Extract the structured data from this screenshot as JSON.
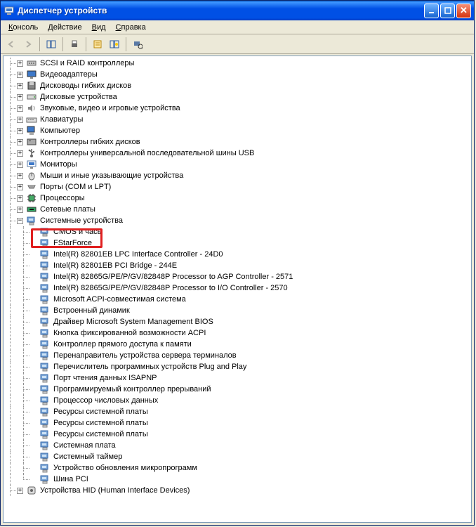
{
  "window": {
    "title": "Диспетчер устройств"
  },
  "menu": {
    "console": "Консоль",
    "action": "Действие",
    "view": "Вид",
    "help": "Справка"
  },
  "tree": [
    {
      "label": "SCSI и RAID контроллеры",
      "expand": "+",
      "icon": "scsi",
      "depth": 1
    },
    {
      "label": "Видеоадаптеры",
      "expand": "+",
      "icon": "display",
      "depth": 1
    },
    {
      "label": "Дисководы гибких дисков",
      "expand": "+",
      "icon": "floppy",
      "depth": 1
    },
    {
      "label": "Дисковые устройства",
      "expand": "+",
      "icon": "disk",
      "depth": 1
    },
    {
      "label": "Звуковые, видео и игровые устройства",
      "expand": "+",
      "icon": "sound",
      "depth": 1
    },
    {
      "label": "Клавиатуры",
      "expand": "+",
      "icon": "keyboard",
      "depth": 1
    },
    {
      "label": "Компьютер",
      "expand": "+",
      "icon": "computer",
      "depth": 1
    },
    {
      "label": "Контроллеры гибких дисков",
      "expand": "+",
      "icon": "fdc",
      "depth": 1
    },
    {
      "label": "Контроллеры универсальной последовательной шины USB",
      "expand": "+",
      "icon": "usb",
      "depth": 1
    },
    {
      "label": "Мониторы",
      "expand": "+",
      "icon": "monitor",
      "depth": 1
    },
    {
      "label": "Мыши и иные указывающие устройства",
      "expand": "+",
      "icon": "mouse",
      "depth": 1
    },
    {
      "label": "Порты (COM и LPT)",
      "expand": "+",
      "icon": "port",
      "depth": 1
    },
    {
      "label": "Процессоры",
      "expand": "+",
      "icon": "cpu",
      "depth": 1
    },
    {
      "label": "Сетевые платы",
      "expand": "+",
      "icon": "net",
      "depth": 1
    },
    {
      "label": "Системные устройства",
      "expand": "-",
      "icon": "system",
      "depth": 1
    },
    {
      "label": "CMOS и часы",
      "expand": "",
      "icon": "system",
      "depth": 2,
      "obscured": true
    },
    {
      "label": "FStarForce",
      "expand": "",
      "icon": "system",
      "depth": 2,
      "highlighted": true
    },
    {
      "label": "Intel(R) 82801EB LPC Interface Controller - 24D0",
      "expand": "",
      "icon": "system",
      "depth": 2
    },
    {
      "label": "Intel(R) 82801EB PCI Bridge - 244E",
      "expand": "",
      "icon": "system",
      "depth": 2
    },
    {
      "label": "Intel(R) 82865G/PE/P/GV/82848P Processor to AGP Controller - 2571",
      "expand": "",
      "icon": "system",
      "depth": 2
    },
    {
      "label": "Intel(R) 82865G/PE/P/GV/82848P Processor to I/O Controller - 2570",
      "expand": "",
      "icon": "system",
      "depth": 2
    },
    {
      "label": "Microsoft ACPI-совместимая система",
      "expand": "",
      "icon": "system",
      "depth": 2
    },
    {
      "label": "Встроенный динамик",
      "expand": "",
      "icon": "system",
      "depth": 2
    },
    {
      "label": "Драйвер Microsoft System Management BIOS",
      "expand": "",
      "icon": "system",
      "depth": 2
    },
    {
      "label": "Кнопка фиксированной возможности ACPI",
      "expand": "",
      "icon": "system",
      "depth": 2
    },
    {
      "label": "Контроллер прямого доступа к памяти",
      "expand": "",
      "icon": "system",
      "depth": 2
    },
    {
      "label": "Перенаправитель устройства сервера терминалов",
      "expand": "",
      "icon": "system",
      "depth": 2
    },
    {
      "label": "Перечислитель программных устройств Plug and Play",
      "expand": "",
      "icon": "system",
      "depth": 2
    },
    {
      "label": "Порт чтения данных ISAPNP",
      "expand": "",
      "icon": "system",
      "depth": 2
    },
    {
      "label": "Программируемый контроллер прерываний",
      "expand": "",
      "icon": "system",
      "depth": 2
    },
    {
      "label": "Процессор числовых данных",
      "expand": "",
      "icon": "system",
      "depth": 2
    },
    {
      "label": "Ресурсы системной платы",
      "expand": "",
      "icon": "system",
      "depth": 2
    },
    {
      "label": "Ресурсы системной платы",
      "expand": "",
      "icon": "system",
      "depth": 2
    },
    {
      "label": "Ресурсы системной платы",
      "expand": "",
      "icon": "system",
      "depth": 2
    },
    {
      "label": "Системная плата",
      "expand": "",
      "icon": "system",
      "depth": 2
    },
    {
      "label": "Системный таймер",
      "expand": "",
      "icon": "system",
      "depth": 2
    },
    {
      "label": "Устройство обновления микропрограмм",
      "expand": "",
      "icon": "system",
      "depth": 2
    },
    {
      "label": "Шина PCI",
      "expand": "",
      "icon": "system",
      "depth": 2,
      "last": true
    },
    {
      "label": "Устройства HID (Human Interface Devices)",
      "expand": "+",
      "icon": "hid",
      "depth": 1
    }
  ],
  "colors": {
    "highlight": "#e02020"
  }
}
